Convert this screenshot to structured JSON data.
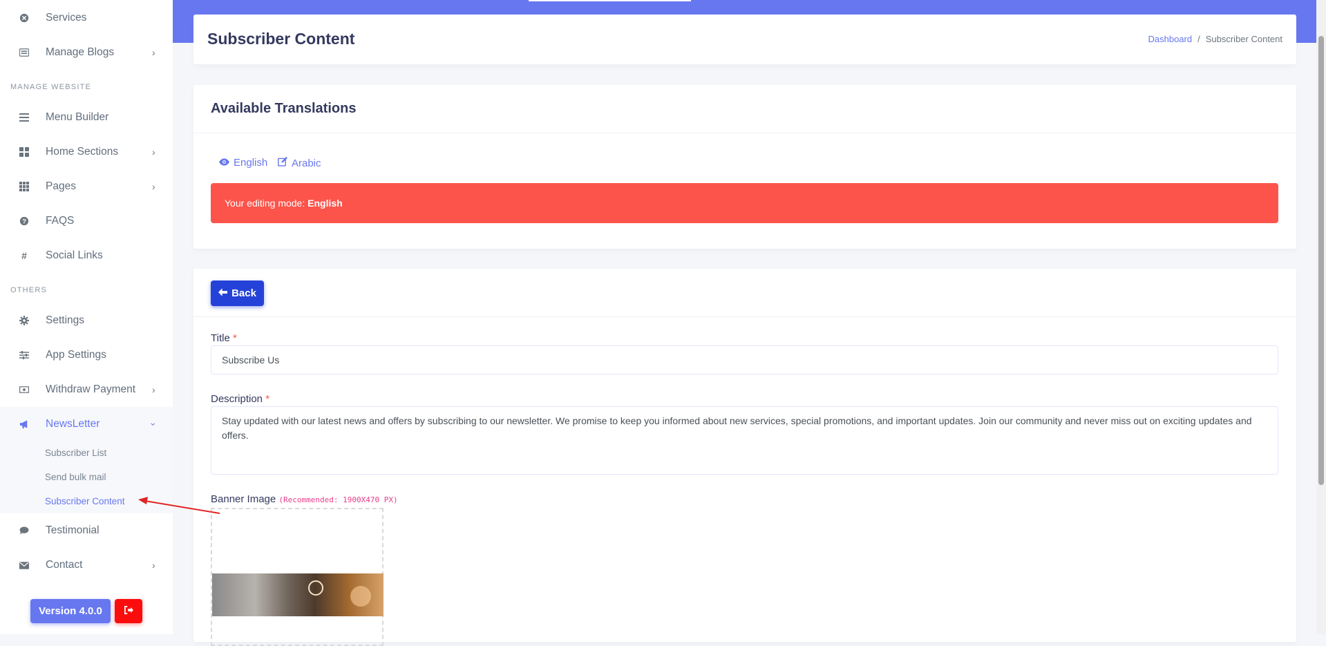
{
  "sidebar": {
    "items": [
      {
        "label": "Services",
        "icon": "times-circle-icon"
      },
      {
        "label": "Manage Blogs",
        "icon": "list-alt-icon"
      },
      {
        "label": "Menu Builder",
        "icon": "bars-icon"
      },
      {
        "label": "Home Sections",
        "icon": "th-large-icon"
      },
      {
        "label": "Pages",
        "icon": "th-icon"
      },
      {
        "label": "FAQS",
        "icon": "question-circle-icon"
      },
      {
        "label": "Social Links",
        "icon": "hashtag-icon"
      },
      {
        "label": "Settings",
        "icon": "cog-icon"
      },
      {
        "label": "App Settings",
        "icon": "sliders-icon"
      },
      {
        "label": "Withdraw Payment",
        "icon": "money-bill-icon"
      },
      {
        "label": "NewsLetter",
        "icon": "bullhorn-icon"
      },
      {
        "label": "Testimonial",
        "icon": "comment-icon"
      },
      {
        "label": "Contact",
        "icon": "envelope-icon"
      }
    ],
    "headers": [
      "Manage Website",
      "Others"
    ],
    "newsletter_sub": [
      "Subscriber List",
      "Send bulk mail",
      "Subscriber Content"
    ],
    "version": "Version 4.0.0"
  },
  "header": {
    "title": "Subscriber Content",
    "breadcrumb": {
      "home": "Dashboard",
      "sep": "/",
      "current": "Subscriber Content"
    }
  },
  "translations": {
    "title": "Available Translations",
    "english": "English",
    "arabic": "Arabic",
    "alert_prefix": "Your editing mode:",
    "alert_lang": "English"
  },
  "form": {
    "back": "Back",
    "title_label": "Title",
    "title_value": "Subscribe Us",
    "description_label": "Description",
    "description_value": "Stay updated with our latest news and offers by subscribing to our newsletter. We promise to keep you informed about new services, special promotions, and important updates. Join our community and never miss out on exciting updates and offers.",
    "banner_label": "Banner Image",
    "banner_hint": "(Recommended: 1900X470 PX)",
    "required_mark": "*"
  },
  "colors": {
    "primary": "#6777ef",
    "danger": "#fc544b",
    "back_button": "#2542d8",
    "logout": "#fc0d0d"
  }
}
